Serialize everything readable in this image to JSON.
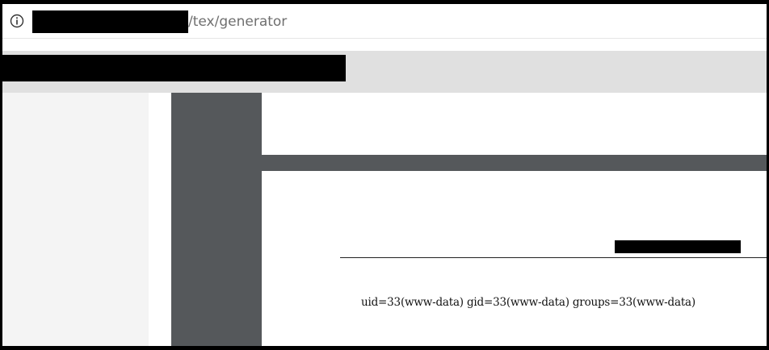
{
  "address_bar": {
    "info_icon": "info-icon",
    "url_suffix": "/tex/generator"
  },
  "document": {
    "output_text": "uid=33(www-data) gid=33(www-data) groups=33(www-data)"
  }
}
